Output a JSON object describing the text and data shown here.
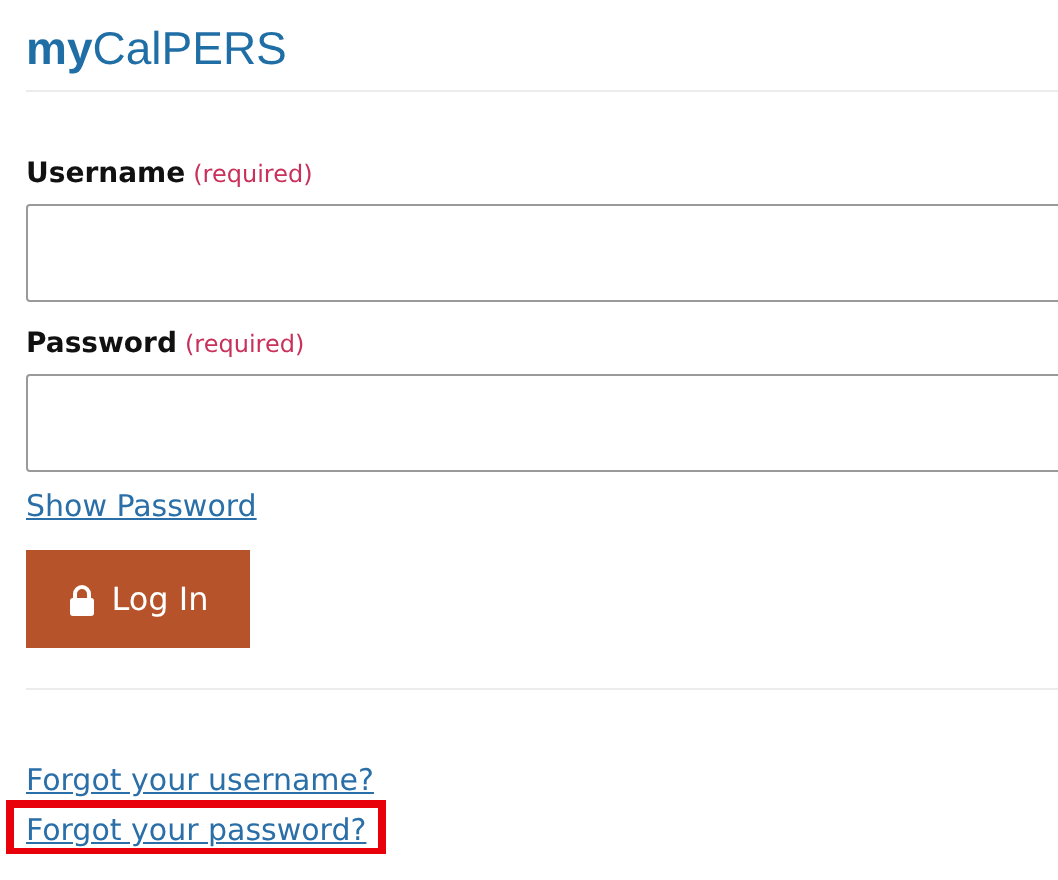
{
  "logo": "**my**CalPERS",
  "fields": [
    {
      "label": "Username",
      "note": "(required)"
    },
    {
      "label": "Password",
      "note": "(required)"
    }
  ],
  "show_password": "Show Password",
  "login_button": {
    "label": "Log In"
  },
  "links": [
    {
      "text": "Forgot your username?",
      "highlighted": false
    },
    {
      "text": "Forgot your password?",
      "highlighted": true
    }
  ]
}
